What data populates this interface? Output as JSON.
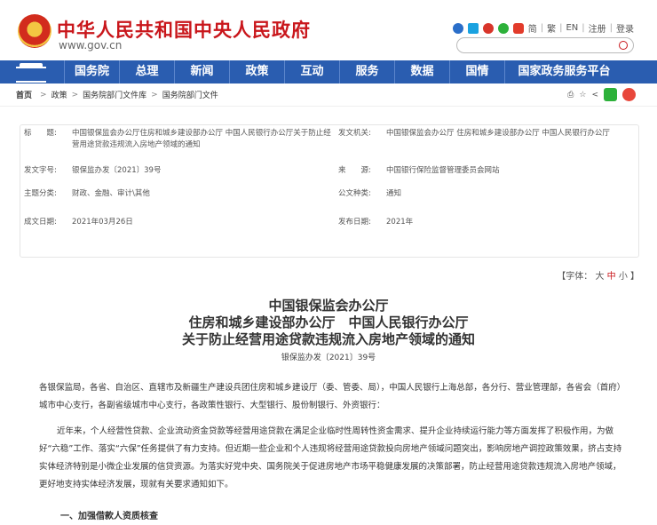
{
  "header": {
    "title": "中华人民共和国中央人民政府",
    "url": "www.gov.cn",
    "links": [
      "简",
      "繁",
      "EN",
      "注册",
      "登录"
    ]
  },
  "nav": [
    "国务院",
    "总理",
    "新闻",
    "政策",
    "互动",
    "服务",
    "数据",
    "国情",
    "国家政务服务平台"
  ],
  "breadcrumb": {
    "home": "首页",
    "items": [
      "政策",
      "国务院部门文件库",
      "国务院部门文件"
    ]
  },
  "meta": {
    "title_key": "标　　题:",
    "title_val": "中国银保监会办公厅住房和城乡建设部办公厅 中国人民银行办公厅关于防止经营用途贷款违规流入房地产领域的通知",
    "issuer_key": "发文机关:",
    "issuer_val": "中国银保监会办公厅 住房和城乡建设部办公厅 中国人民银行办公厅",
    "docno_key": "发文字号:",
    "docno_val": "银保监办发〔2021〕39号",
    "source_key": "来　　源:",
    "source_val": "中国银行保险监督管理委员会网站",
    "topic_key": "主题分类:",
    "topic_val": "财政、金融、审计\\其他",
    "genre_key": "公文种类:",
    "genre_val": "通知",
    "date_key": "成文日期:",
    "date_val": "2021年03月26日",
    "pub_key": "发布日期:",
    "pub_val": "2021年"
  },
  "fontsize": {
    "label": "【字体：",
    "large": "大",
    "mid": "中",
    "small": "小",
    "end": "】"
  },
  "article": {
    "title1": "中国银保监会办公厅",
    "title2": "住房和城乡建设部办公厅　中国人民银行办公厅",
    "title3": "关于防止经营用途贷款违规流入房地产领域的通知",
    "docno": "银保监办发〔2021〕39号",
    "p1": "各银保监局，各省、自治区、直辖市及新疆生产建设兵团住房和城乡建设厅（委、管委、局），中国人民银行上海总部，各分行、营业管理部，各省会（首府）城市中心支行，各副省级城市中心支行，各政策性银行、大型银行、股份制银行、外资银行：",
    "p2": "近年来，个人经营性贷款、企业流动资金贷款等经营用途贷款在满足企业临时性周转性资金需求、提升企业持续运行能力等方面发挥了积极作用，为做好“六稳”工作、落实“六保”任务提供了有力支持。但近期一些企业和个人违规将经营用途贷款投向房地产领域问题突出，影响房地产调控政策效果，挤占支持实体经济特别是小微企业发展的信贷资源。为落实好党中央、国务院关于促进房地产市场平稳健康发展的决策部署，防止经营用途贷款违规流入房地产领域，更好地支持实体经济发展，现就有关要求通知如下。",
    "h1": "一、加强借款人资质核查"
  }
}
